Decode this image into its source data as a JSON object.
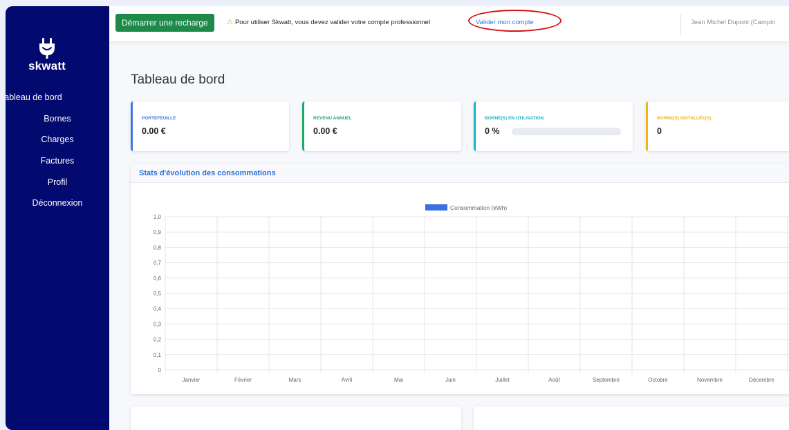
{
  "brand": {
    "name": "skwatt"
  },
  "sidebar": {
    "items": [
      {
        "label": "Tableau de bord"
      },
      {
        "label": "Bornes"
      },
      {
        "label": "Charges"
      },
      {
        "label": "Factures"
      },
      {
        "label": "Profil"
      },
      {
        "label": "Déconnexion"
      }
    ]
  },
  "topbar": {
    "start_button": "Démarrer une recharge",
    "warning_text": "Pour utiliser Skwatt, vous devez valider votre compte professionnel",
    "validate_link": "Valider mon compte",
    "user_name": "Jean Michel Dupont (Campin"
  },
  "page": {
    "title": "Tableau de bord"
  },
  "cards": [
    {
      "label": "PORTEFEUILLE",
      "value": "0.00 €",
      "color": "#3d78e0"
    },
    {
      "label": "REVENU ANNUEL",
      "value": "0.00 €",
      "color": "#1ea86a"
    },
    {
      "label": "BORNE(S) EN UTILISATION",
      "value": "0 %",
      "color": "#1ab3c8",
      "progress": 0
    },
    {
      "label": "BORNE(S) INSTALLÉE(S)",
      "value": "0",
      "color": "#f0b41c"
    }
  ],
  "colors": {
    "sidebar": "#02096f",
    "primary_button": "#1e8a4a",
    "link": "#2e7be4",
    "annotation": "#d31111"
  },
  "chart_section": {
    "title": "Stats d'évolution des consommations"
  },
  "chart_data": {
    "type": "bar",
    "series": [
      {
        "name": "Consommation (kWh)",
        "color": "#3d6fe0",
        "values": [
          0,
          0,
          0,
          0,
          0,
          0,
          0,
          0,
          0,
          0,
          0,
          0
        ]
      }
    ],
    "categories": [
      "Janvier",
      "Février",
      "Mars",
      "Avril",
      "Mai",
      "Juin",
      "Juillet",
      "Août",
      "Septembre",
      "Octobre",
      "Novembre",
      "Décembre"
    ],
    "ylim": [
      0,
      1
    ],
    "yticks": [
      "0",
      "0,1",
      "0,2",
      "0,3",
      "0,4",
      "0,5",
      "0,6",
      "0,7",
      "0,8",
      "0,9",
      "1,0"
    ],
    "grid": true,
    "legend": "top"
  }
}
